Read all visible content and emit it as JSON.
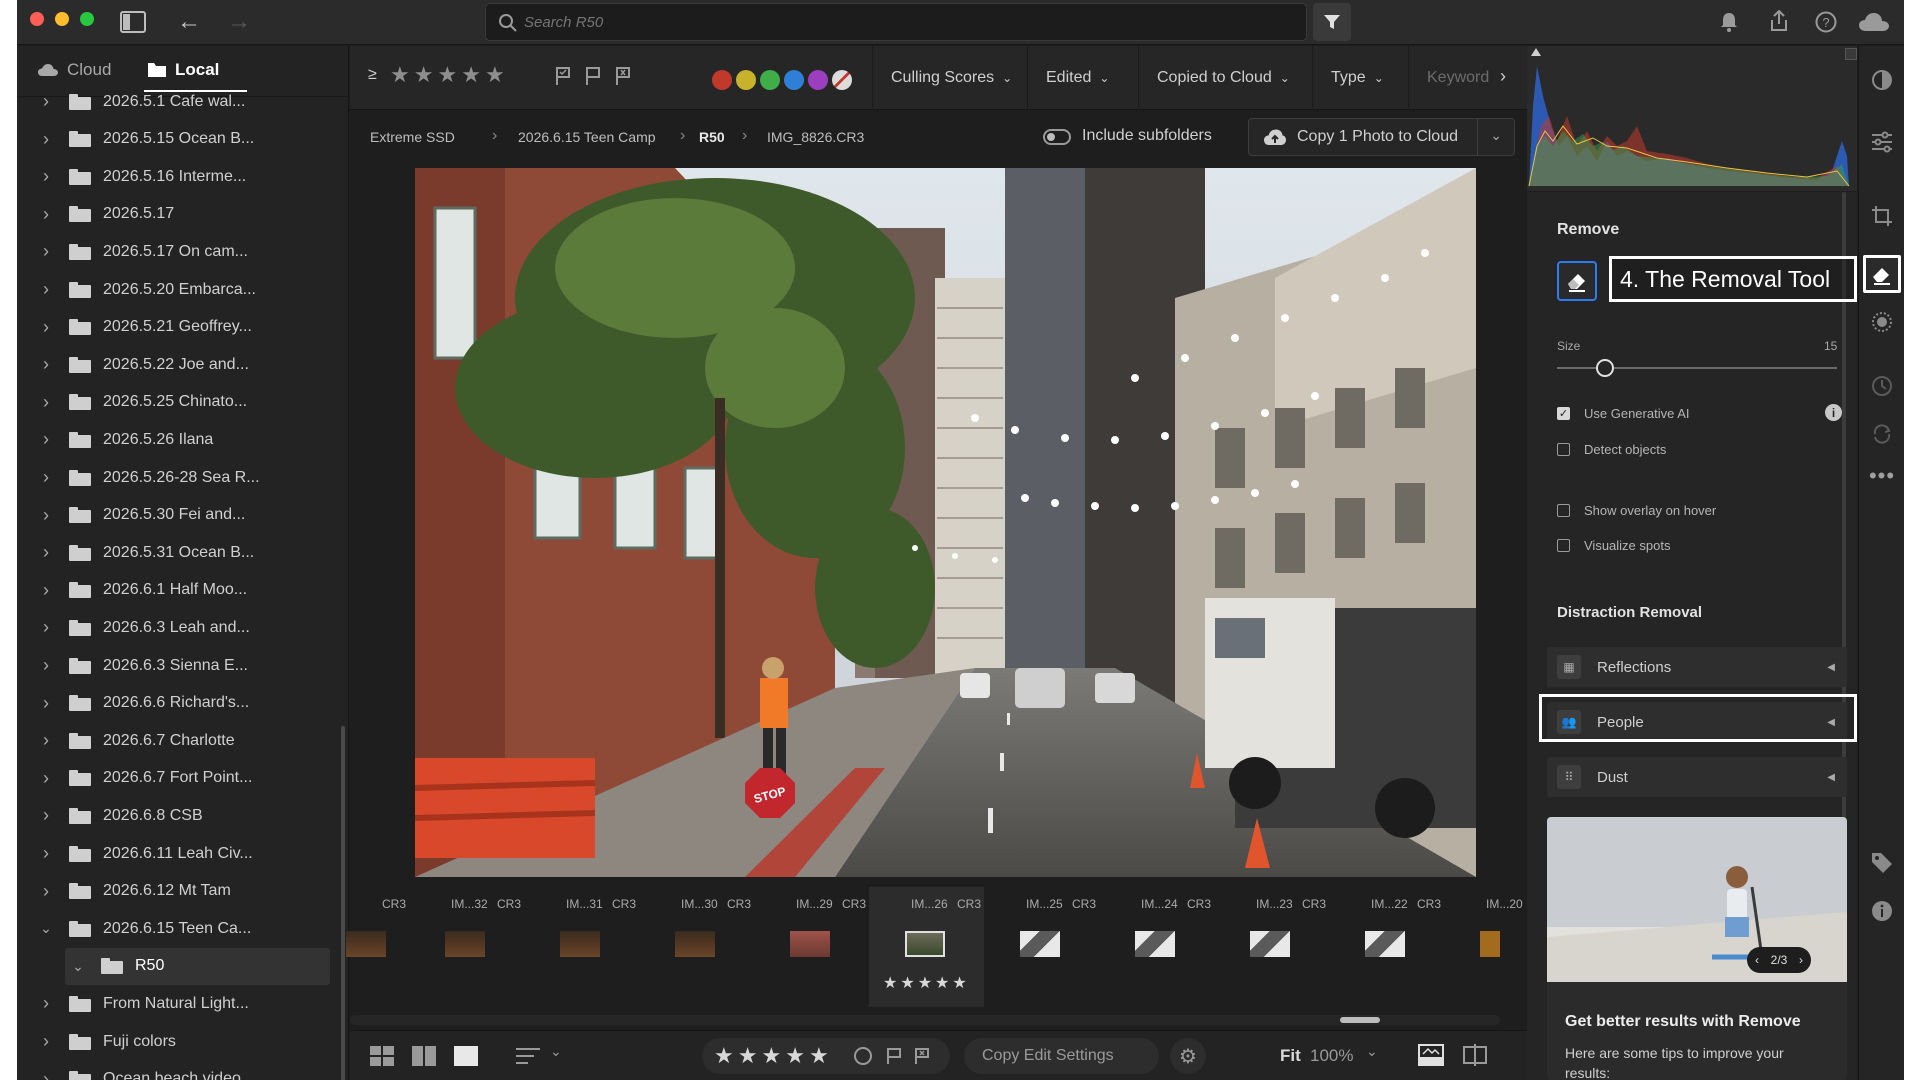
{
  "titlebar": {
    "search_placeholder": "Search R50"
  },
  "left_panel": {
    "tabs": [
      {
        "label": "Cloud",
        "active": false
      },
      {
        "label": "Local",
        "active": true
      }
    ],
    "folders": [
      {
        "label": "2026.5.1 Cafe wal...",
        "expanded": false,
        "partial": true
      },
      {
        "label": "2026.5.15 Ocean B...",
        "expanded": false
      },
      {
        "label": "2026.5.16 Interme...",
        "expanded": false
      },
      {
        "label": "2026.5.17",
        "expanded": false
      },
      {
        "label": "2026.5.17 On cam...",
        "expanded": false
      },
      {
        "label": "2026.5.20 Embarca...",
        "expanded": false
      },
      {
        "label": "2026.5.21 Geoffrey...",
        "expanded": false
      },
      {
        "label": "2026.5.22 Joe and...",
        "expanded": false
      },
      {
        "label": "2026.5.25 Chinato...",
        "expanded": false
      },
      {
        "label": "2026.5.26 Ilana",
        "expanded": false
      },
      {
        "label": "2026.5.26-28 Sea R...",
        "expanded": false
      },
      {
        "label": "2026.5.30 Fei and...",
        "expanded": false
      },
      {
        "label": "2026.5.31 Ocean B...",
        "expanded": false
      },
      {
        "label": "2026.6.1 Half Moo...",
        "expanded": false
      },
      {
        "label": "2026.6.3 Leah and...",
        "expanded": false
      },
      {
        "label": "2026.6.3 Sienna E...",
        "expanded": false
      },
      {
        "label": "2026.6.6 Richard's...",
        "expanded": false
      },
      {
        "label": "2026.6.7 Charlotte",
        "expanded": false
      },
      {
        "label": "2026.6.7 Fort Point...",
        "expanded": false
      },
      {
        "label": "2026.6.8 CSB",
        "expanded": false
      },
      {
        "label": "2026.6.11 Leah Civ...",
        "expanded": false
      },
      {
        "label": "2026.6.12 Mt Tam",
        "expanded": false
      },
      {
        "label": "2026.6.15 Teen Ca...",
        "expanded": true
      },
      {
        "label": "R50",
        "expanded": true,
        "child": true,
        "selected": true
      },
      {
        "label": "From Natural Light...",
        "expanded": false
      },
      {
        "label": "Fuji colors",
        "expanded": false
      },
      {
        "label": "Ocean beach video",
        "expanded": false,
        "partial": true
      }
    ]
  },
  "toolbar": {
    "ge_symbol": "≥",
    "dropdowns": [
      "Culling Scores",
      "Edited",
      "Copied to Cloud",
      "Type",
      "Keyword"
    ],
    "color_labels": [
      "#c0392b",
      "#c9b22b",
      "#3fae49",
      "#2f7fd6",
      "#9b3fbf"
    ]
  },
  "breadcrumb": {
    "items": [
      "Extreme SSD",
      "2026.6.15 Teen Camp",
      "R50",
      "IMG_8826.CR3"
    ],
    "include_subfolders_label": "Include subfolders",
    "copy_button_label": "Copy 1 Photo to Cloud"
  },
  "filmstrip": {
    "items": [
      {
        "name": "",
        "type": "CR3"
      },
      {
        "name": "IM...32",
        "type": "CR3"
      },
      {
        "name": "IM...31",
        "type": "CR3"
      },
      {
        "name": "IM...30",
        "type": "CR3"
      },
      {
        "name": "IM...29",
        "type": "CR3"
      },
      {
        "name": "IM...26",
        "type": "CR3",
        "selected": true
      },
      {
        "name": "IM...25",
        "type": "CR3"
      },
      {
        "name": "IM...24",
        "type": "CR3"
      },
      {
        "name": "IM...23",
        "type": "CR3"
      },
      {
        "name": "IM...22",
        "type": "CR3"
      },
      {
        "name": "IM...20",
        "type": ""
      }
    ],
    "selected_rating": "★★★★★"
  },
  "bottombar": {
    "copy_edit_settings_label": "Copy Edit Settings",
    "fit_label": "Fit",
    "zoom_label": "100%"
  },
  "right_panel": {
    "remove_title": "Remove",
    "callout_label": "4. The Removal Tool",
    "size_label": "Size",
    "size_value": "15",
    "size_fraction": 0.17,
    "checkboxes": [
      {
        "label": "Use Generative AI",
        "checked": true
      },
      {
        "label": "Detect objects",
        "checked": false
      },
      {
        "label": "Show overlay on hover",
        "checked": false
      },
      {
        "label": "Visualize spots",
        "checked": false
      }
    ],
    "distraction_title": "Distraction Removal",
    "distraction_items": [
      "Reflections",
      "People",
      "Dust"
    ],
    "tip_pager": "2/3",
    "tip_title": "Get better results with Remove",
    "tip_body": "Here are some tips to improve your results:"
  }
}
